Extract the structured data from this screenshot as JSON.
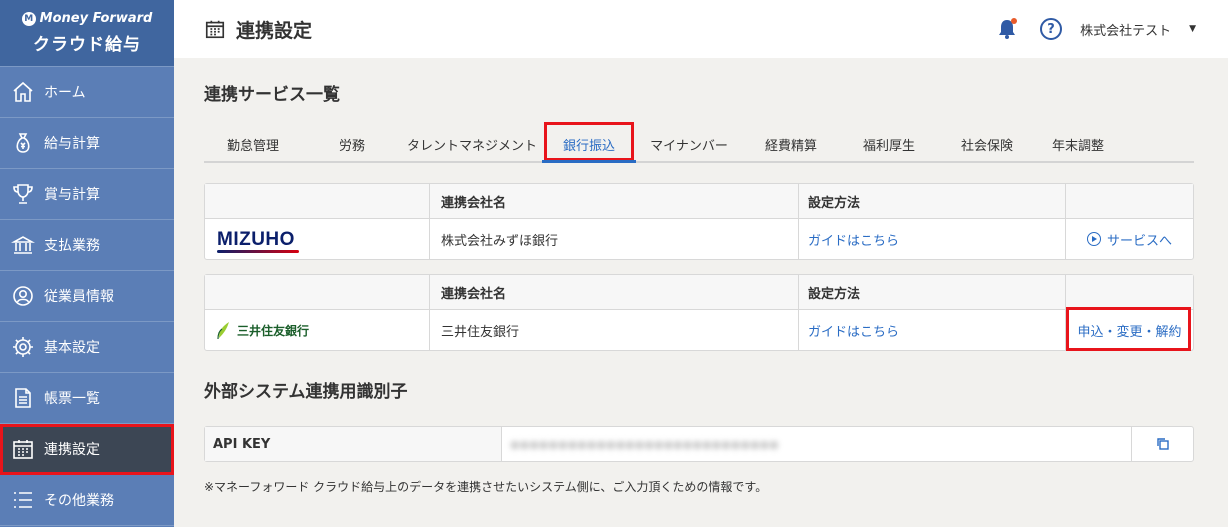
{
  "brand": {
    "top": "Money Forward",
    "sub": "クラウド給与"
  },
  "sidebar": {
    "items": [
      {
        "label": "ホーム",
        "icon": "home-icon"
      },
      {
        "label": "給与計算",
        "icon": "money-bag-icon"
      },
      {
        "label": "賞与計算",
        "icon": "trophy-icon"
      },
      {
        "label": "支払業務",
        "icon": "bank-icon"
      },
      {
        "label": "従業員情報",
        "icon": "person-icon"
      },
      {
        "label": "基本設定",
        "icon": "gear-icon"
      },
      {
        "label": "帳票一覧",
        "icon": "document-icon"
      },
      {
        "label": "連携設定",
        "icon": "calendar-icon",
        "active": true
      },
      {
        "label": "その他業務",
        "icon": "list-icon"
      }
    ]
  },
  "header": {
    "title": "連携設定",
    "company": "株式会社テスト"
  },
  "main": {
    "section_title": "連携サービス一覧",
    "tabs": [
      {
        "label": "勤怠管理"
      },
      {
        "label": "労務"
      },
      {
        "label": "タレントマネジメント"
      },
      {
        "label": "銀行振込",
        "active": true
      },
      {
        "label": "マイナンバー"
      },
      {
        "label": "経費精算"
      },
      {
        "label": "福利厚生"
      },
      {
        "label": "社会保険"
      },
      {
        "label": "年末調整"
      }
    ],
    "table_headers": {
      "company": "連携会社名",
      "method": "設定方法"
    },
    "services": [
      {
        "logo_text": "MIZUHO",
        "company": "株式会社みずほ銀行",
        "guide": "ガイドはこちら",
        "action": "サービスへ"
      },
      {
        "logo_text": "三井住友銀行",
        "company": "三井住友銀行",
        "guide": "ガイドはこちら",
        "action": "申込・変更・解約"
      }
    ],
    "api_section_title": "外部システム連携用識別子",
    "api_label": "API KEY",
    "api_value": "●●●●●●●●●●●●●●●●●●●●●●●●●●●●",
    "note": "※マネーフォワード クラウド給与上のデータを連携させたいシステム側に、ご入力頂くための情報です。"
  },
  "colors": {
    "sidebar": "#5b7eb6",
    "brand_bg": "#40669f",
    "active_nav": "#3c4654",
    "link": "#2a6cc4",
    "highlight": "#e8141b"
  }
}
